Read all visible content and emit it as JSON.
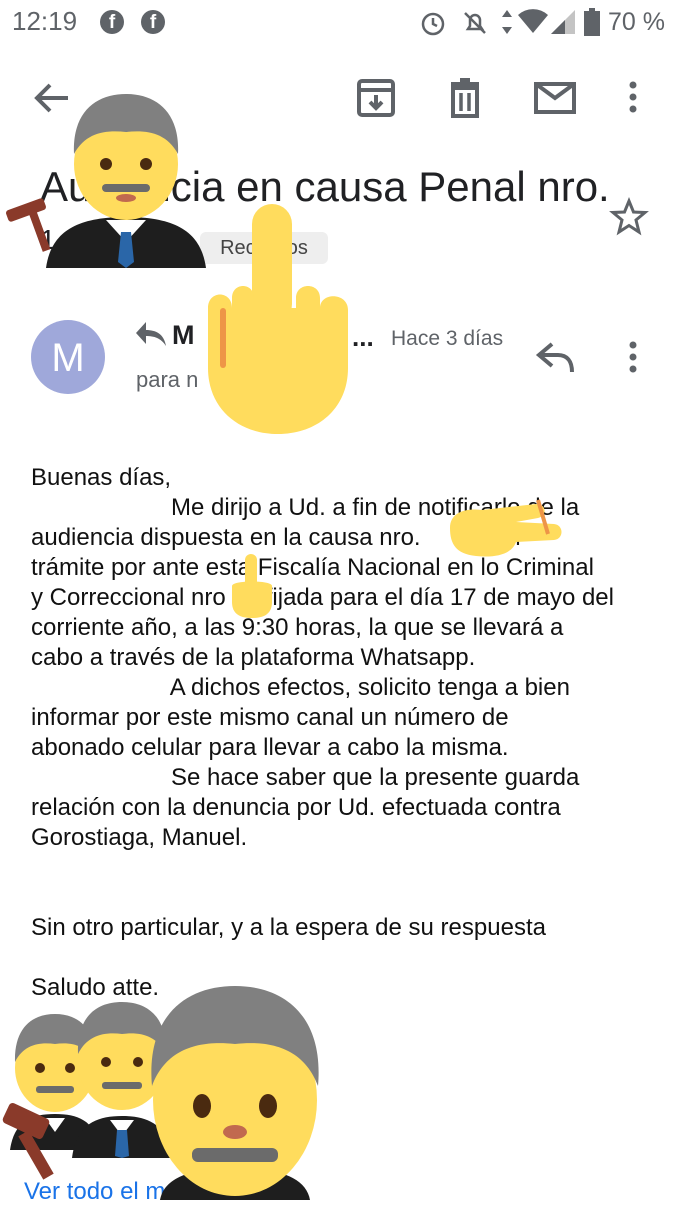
{
  "status_bar": {
    "time": "12:19",
    "battery": "70 %",
    "notification_icons": [
      "facebook-icon",
      "facebook-icon"
    ],
    "system_icons": [
      "alarm-icon",
      "mute-icon",
      "data-icon",
      "wifi-icon",
      "signal-icon",
      "battery-icon"
    ]
  },
  "toolbar": {
    "icons": [
      "back-arrow-icon",
      "archive-icon",
      "delete-icon",
      "mark-unread-icon",
      "more-vert-icon"
    ]
  },
  "email": {
    "subject": "Audiencia en causa Penal nro.",
    "subject_overflow": "1",
    "label": "Recibidos",
    "sender_initial": "M",
    "sender_name": "M",
    "sender_ellipsis": "...",
    "date": "Hace 3 días",
    "to_label": "para n",
    "body": {
      "greeting": "Buenas días,",
      "lines": [
        "                     Me dirijo a Ud. a fin de notificarlo de la",
        "audiencia dispuesta en la causa nro.           en",
        "trámite por ante esta Fiscalía Nacional en lo Criminal",
        "y Correccional nro      fijada para el día 17 de mayo del",
        "corriente año, a las 9:30 horas, la que se llevará a",
        "cabo a través de la plataforma Whatsapp.",
        "                     A dichos efectos, solicito tenga a bien",
        "informar por este mismo canal un número de",
        "abonado celular para llevar a cabo la misma.",
        "                     Se hace saber que la presente guarda",
        "relación con la denuncia por Ud. efectuada contra",
        "Gorostiaga, Manuel."
      ],
      "closing": "Sin otro particular, y a la espera de su respuesta",
      "signoff": "Saludo atte."
    },
    "view_all_link": "Ver todo el m"
  },
  "colors": {
    "avatar": "#9fa8da",
    "emoji_skin": "#ffdc5d",
    "emoji_hair": "#808080",
    "link": "#1a73e8",
    "chip_bg": "#eeeeee"
  },
  "overlays": [
    "judge-emoji",
    "middle-finger-emoji",
    "hand-emoji",
    "judge-emoji",
    "judge-emoji",
    "judge-emoji"
  ]
}
